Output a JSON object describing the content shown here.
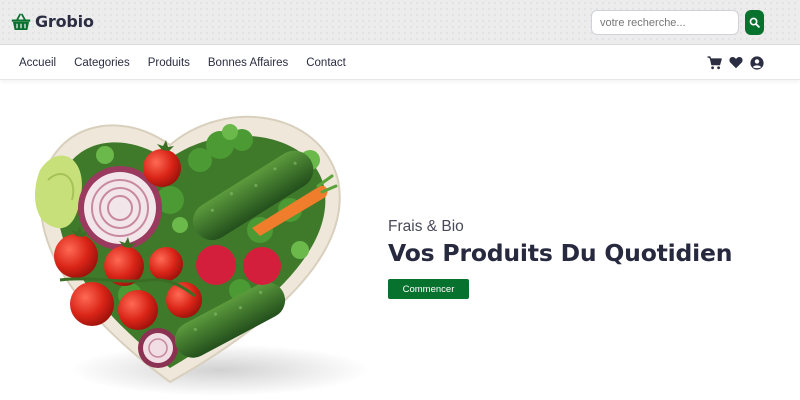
{
  "brand": {
    "name": "Grobio",
    "icon": "basket-icon",
    "color": "#07712e"
  },
  "search": {
    "placeholder": "votre recherche...",
    "value": "",
    "icon": "search-icon"
  },
  "nav": {
    "links": [
      "Accueil",
      "Categories",
      "Produits",
      "Bonnes Affaires",
      "Contact"
    ],
    "icons": [
      "cart-icon",
      "heart-icon",
      "user-icon"
    ]
  },
  "hero": {
    "subtitle": "Frais & Bio",
    "title": "Vos Produits Du Quotidien",
    "cta_label": "Commencer",
    "image": "heart-shaped-bowl-of-vegetables",
    "accent": "#07712e",
    "title_color": "#27293f"
  }
}
